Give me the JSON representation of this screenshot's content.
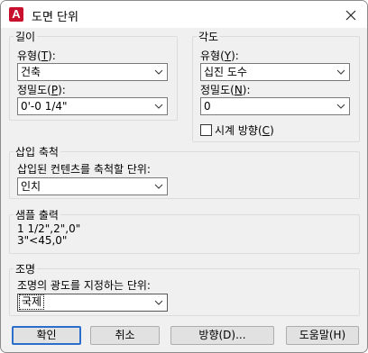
{
  "window": {
    "title": "도면 단위",
    "app_icon_letter": "A"
  },
  "length": {
    "group_title": "길이",
    "type_label_pre": "유형(",
    "type_label_key": "T",
    "type_label_post": "):",
    "type_value": "건축",
    "precision_label_pre": "정밀도(",
    "precision_label_key": "P",
    "precision_label_post": "):",
    "precision_value": "0'-0 1/4\""
  },
  "angle": {
    "group_title": "각도",
    "type_label_pre": "유형(",
    "type_label_key": "Y",
    "type_label_post": "):",
    "type_value": "십진 도수",
    "precision_label_pre": "정밀도(",
    "precision_label_key": "N",
    "precision_label_post": "):",
    "precision_value": "0",
    "clockwise_label_pre": "시계 방향(",
    "clockwise_label_key": "C",
    "clockwise_label_post": ")",
    "clockwise_checked": false
  },
  "insertion": {
    "group_title": "삽입 축척",
    "units_label": "삽입된 컨텐츠를 축척할 단위:",
    "units_value": "인치"
  },
  "sample": {
    "group_title": "샘플 출력",
    "line1": "1 1/2\",2\",0\"",
    "line2": "3\"<45,0\""
  },
  "lighting": {
    "group_title": "조명",
    "units_label": "조명의 광도를 지정하는 단위:",
    "units_value": "국제"
  },
  "buttons": {
    "ok": "확인",
    "cancel": "취소",
    "direction": "방향(D)...",
    "help": "도움말(H)"
  }
}
